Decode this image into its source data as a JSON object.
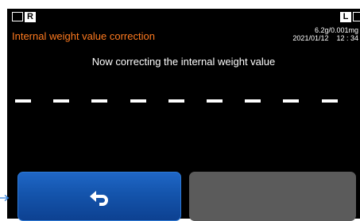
{
  "status_bar": {
    "left_badge": "R",
    "right_badge": "L"
  },
  "header": {
    "title": "Internal weight value correction",
    "capacity_readability": "6.2g/0.001mg",
    "date": "2021/01/12",
    "time": "12 : 34"
  },
  "main": {
    "message": "Now correcting the internal weight value",
    "progress_dash_count": 9
  },
  "colors": {
    "title": "#ff7a1f",
    "back_button": "#1454ac",
    "blank_button": "#5b5b5b",
    "pointer_arrow": "#2a7bd8"
  },
  "footer": {
    "back_icon": "return-arrow-icon"
  }
}
